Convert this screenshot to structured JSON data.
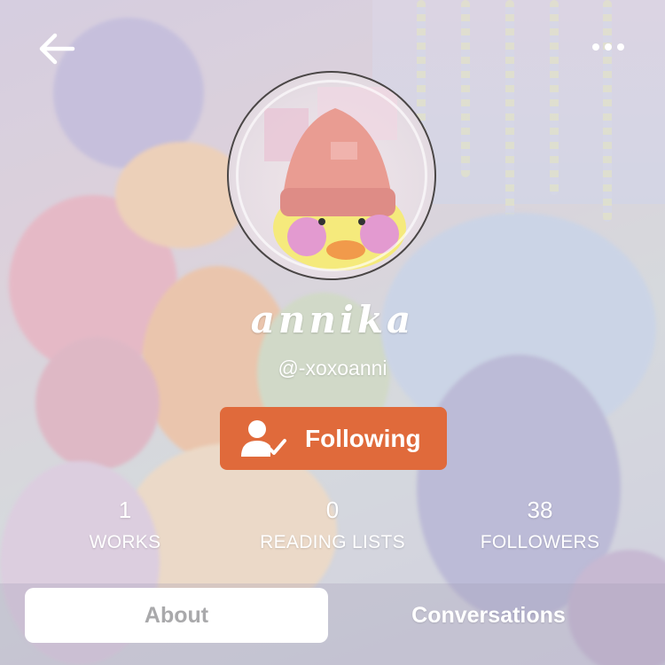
{
  "header": {
    "back_icon": "back-arrow-icon",
    "more_icon": "more-horizontal-icon"
  },
  "profile": {
    "display_name": "annika",
    "handle": "@-xoxoanni",
    "follow_button": {
      "label": "Following",
      "icon": "user-check-icon",
      "color": "#e06a3b"
    }
  },
  "stats": [
    {
      "value": "1",
      "label": "WORKS"
    },
    {
      "value": "0",
      "label": "READING LISTS"
    },
    {
      "value": "38",
      "label": "FOLLOWERS"
    }
  ],
  "tabs": {
    "about": "About",
    "conversations": "Conversations"
  }
}
